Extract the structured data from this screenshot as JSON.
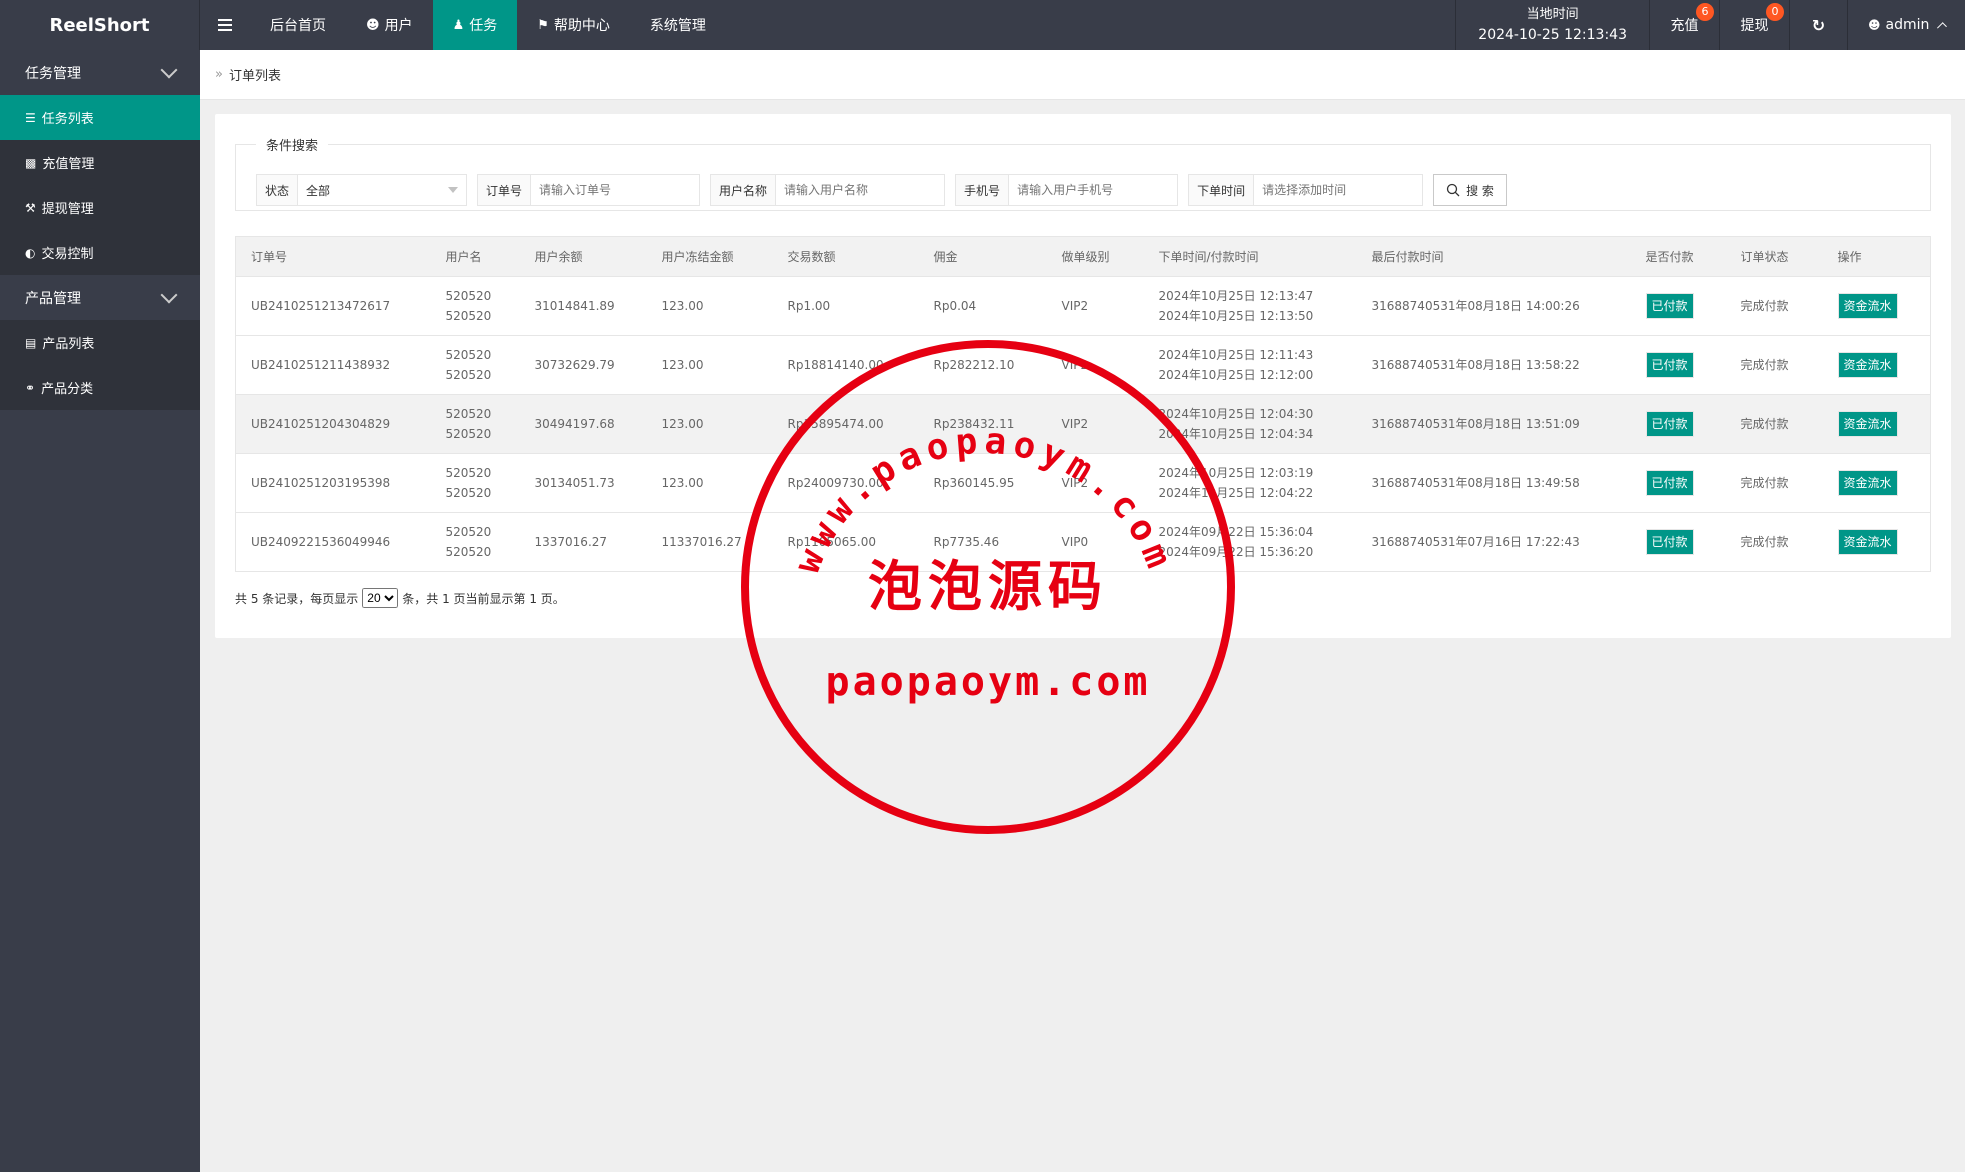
{
  "app": {
    "logo": "ReelShort"
  },
  "nav": [
    {
      "label": "后台首页",
      "icon": ""
    },
    {
      "label": "用户",
      "icon": "user-icon"
    },
    {
      "label": "任务",
      "icon": "walk-icon"
    },
    {
      "label": "帮助中心",
      "icon": "flag-icon"
    },
    {
      "label": "系统管理",
      "icon": ""
    }
  ],
  "header": {
    "time_label": "当地时间",
    "time_value": "2024-10-25 12:13:43",
    "recharge": "充值",
    "recharge_badge": "6",
    "withdraw": "提现",
    "withdraw_badge": "0",
    "user": "admin"
  },
  "sidebar": {
    "group1": "任务管理",
    "items1": [
      "任务列表",
      "充值管理",
      "提现管理",
      "交易控制"
    ],
    "group2": "产品管理",
    "items2": [
      "产品列表",
      "产品分类"
    ]
  },
  "breadcrumb": "订单列表",
  "search": {
    "legend": "条件搜索",
    "status_label": "状态",
    "status_value": "全部",
    "order_label": "订单号",
    "order_placeholder": "请输入订单号",
    "username_label": "用户名称",
    "username_placeholder": "请输入用户名称",
    "phone_label": "手机号",
    "phone_placeholder": "请输入用户手机号",
    "time_label": "下单时间",
    "time_placeholder": "请选择添加时间",
    "button": "搜 索"
  },
  "table": {
    "headers": [
      "订单号",
      "用户名",
      "用户余额",
      "用户冻结金额",
      "交易数额",
      "佣金",
      "做单级别",
      "下单时间/付款时间",
      "最后付款时间",
      "是否付款",
      "订单状态",
      "操作"
    ],
    "rows": [
      {
        "order": "UB2410251213472617",
        "user1": "520520",
        "user2": "520520",
        "balance": "31014841.89",
        "frozen": "123.00",
        "amount": "Rp1.00",
        "commission": "Rp0.04",
        "level": "VIP2",
        "t1": "2024年10月25日 12:13:47",
        "t2": "2024年10月25日 12:13:50",
        "last": "31688740531年08月18日 14:00:26",
        "paid": "已付款",
        "state": "完成付款",
        "op": "资金流水"
      },
      {
        "order": "UB2410251211438932",
        "user1": "520520",
        "user2": "520520",
        "balance": "30732629.79",
        "frozen": "123.00",
        "amount": "Rp18814140.00",
        "commission": "Rp282212.10",
        "level": "VIP2",
        "t1": "2024年10月25日 12:11:43",
        "t2": "2024年10月25日 12:12:00",
        "last": "31688740531年08月18日 13:58:22",
        "paid": "已付款",
        "state": "完成付款",
        "op": "资金流水"
      },
      {
        "order": "UB2410251204304829",
        "user1": "520520",
        "user2": "520520",
        "balance": "30494197.68",
        "frozen": "123.00",
        "amount": "Rp15895474.00",
        "commission": "Rp238432.11",
        "level": "VIP2",
        "t1": "2024年10月25日 12:04:30",
        "t2": "2024年10月25日 12:04:34",
        "last": "31688740531年08月18日 13:51:09",
        "paid": "已付款",
        "state": "完成付款",
        "op": "资金流水"
      },
      {
        "order": "UB2410251203195398",
        "user1": "520520",
        "user2": "520520",
        "balance": "30134051.73",
        "frozen": "123.00",
        "amount": "Rp24009730.00",
        "commission": "Rp360145.95",
        "level": "VIP2",
        "t1": "2024年10月25日 12:03:19",
        "t2": "2024年10月25日 12:04:22",
        "last": "31688740531年08月18日 13:49:58",
        "paid": "已付款",
        "state": "完成付款",
        "op": "资金流水"
      },
      {
        "order": "UB2409221536049946",
        "user1": "520520",
        "user2": "520520",
        "balance": "1337016.27",
        "frozen": "11337016.27",
        "amount": "Rp1105065.00",
        "commission": "Rp7735.46",
        "level": "VIP0",
        "t1": "2024年09月22日 15:36:04",
        "t2": "2024年09月22日 15:36:20",
        "last": "31688740531年07月16日 17:22:43",
        "paid": "已付款",
        "state": "完成付款",
        "op": "资金流水"
      }
    ]
  },
  "pager": {
    "prefix": "共 5 条记录，每页显示",
    "page_size": "20",
    "suffix": "条，共 1 页当前显示第 1 页。"
  },
  "watermark": {
    "url_arc": "www.paopaoym.com",
    "cn": "泡泡源码",
    "url": "paopaoym.com"
  },
  "colors": {
    "accent": "#009688",
    "topbar": "#393d49",
    "badge": "#ff5722",
    "stamp": "#e60012"
  }
}
